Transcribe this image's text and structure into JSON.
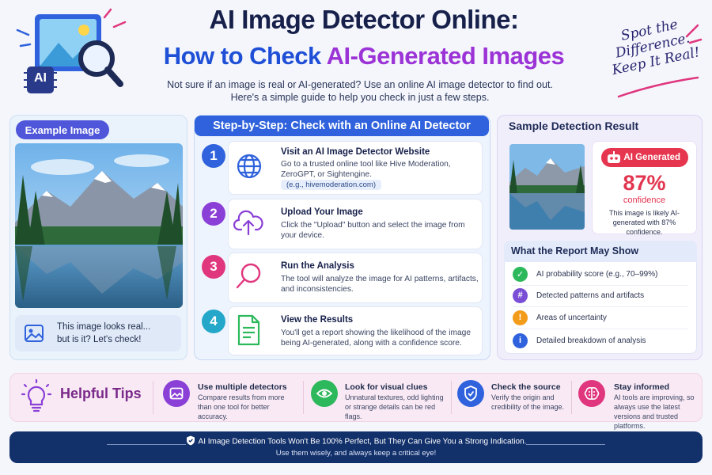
{
  "header": {
    "title_line1": "AI Image Detector Online:",
    "title_line2_a": "How to Check ",
    "title_line2_b": "AI-Generated Images",
    "subtitle": "Not sure if an image is real or AI-generated? Use an online AI image detector to find out. Here's a simple guide to help you check in just a few steps.",
    "badge": "AI",
    "scribble": [
      "Spot the",
      "Difference.",
      "Keep It Real!"
    ]
  },
  "example": {
    "label": "Example Image",
    "caption_line1": "This image looks real...",
    "caption_line2": "but is it? Let's check!"
  },
  "steps_panel": {
    "title": "Step-by-Step:  Check with an Online AI Detector",
    "steps": [
      {
        "num": "1",
        "title": "Visit an AI Image Detector Website",
        "desc": "Go to a trusted online tool like Hive Moderation, ZeroGPT, or Sightengine.",
        "tag": "(e.g., hivemoderation.com)",
        "color": "#2f62dc",
        "icon": "globe-icon"
      },
      {
        "num": "2",
        "title": "Upload Your Image",
        "desc": "Click the \"Upload\" button and select the image from your device.",
        "color": "#8a3fd6",
        "icon": "cloud-upload-icon"
      },
      {
        "num": "3",
        "title": "Run the Analysis",
        "desc": "The tool will analyze the image for AI patterns, artifacts, and inconsistencies.",
        "color": "#e0367e",
        "icon": "magnifier-icon"
      },
      {
        "num": "4",
        "title": "View the Results",
        "desc": "You'll get a report showing the likelihood of the image being AI-generated, along with a confidence score.",
        "color": "#25a7c9",
        "icon": "document-icon"
      }
    ]
  },
  "result": {
    "title": "Sample Detection Result",
    "verdict": "AI Generated",
    "percent": "87%",
    "confidence_label": "confidence",
    "summary": "This image is likely AI-generated with 87% confidence.",
    "report_title": "What the Report May Show",
    "report_items": [
      {
        "text": "AI probability score (e.g., 70–99%)",
        "color": "#2db85b",
        "icon": "check-icon"
      },
      {
        "text": "Detected patterns and artifacts",
        "color": "#7a4fd6",
        "icon": "grid-icon"
      },
      {
        "text": "Areas of uncertainty",
        "color": "#f39c1a",
        "icon": "warning-icon"
      },
      {
        "text": "Detailed breakdown of analysis",
        "color": "#2f62dc",
        "icon": "info-icon"
      }
    ]
  },
  "tips": {
    "title": "Helpful Tips",
    "items": [
      {
        "title": "Use multiple detectors",
        "desc": "Compare results from more than one tool for better accuracy.",
        "color": "#8a3fd6",
        "icon": "image-icon"
      },
      {
        "title": "Look for visual clues",
        "desc": "Unnatural textures, odd lighting or strange details can be red flags.",
        "color": "#2db85b",
        "icon": "eye-icon"
      },
      {
        "title": "Check the source",
        "desc": "Verify the origin and credibility of the image.",
        "color": "#2f62dc",
        "icon": "shield-icon"
      },
      {
        "title": "Stay informed",
        "desc": "AI tools are improving, so always use the latest versions and trusted platforms.",
        "color": "#e0367e",
        "icon": "brain-icon"
      }
    ]
  },
  "footer": {
    "line1": "AI Image Detection Tools Won't Be 100% Perfect, But They Can Give You a Strong Indication.",
    "line2": "Use them wisely, and always keep a critical eye!"
  }
}
